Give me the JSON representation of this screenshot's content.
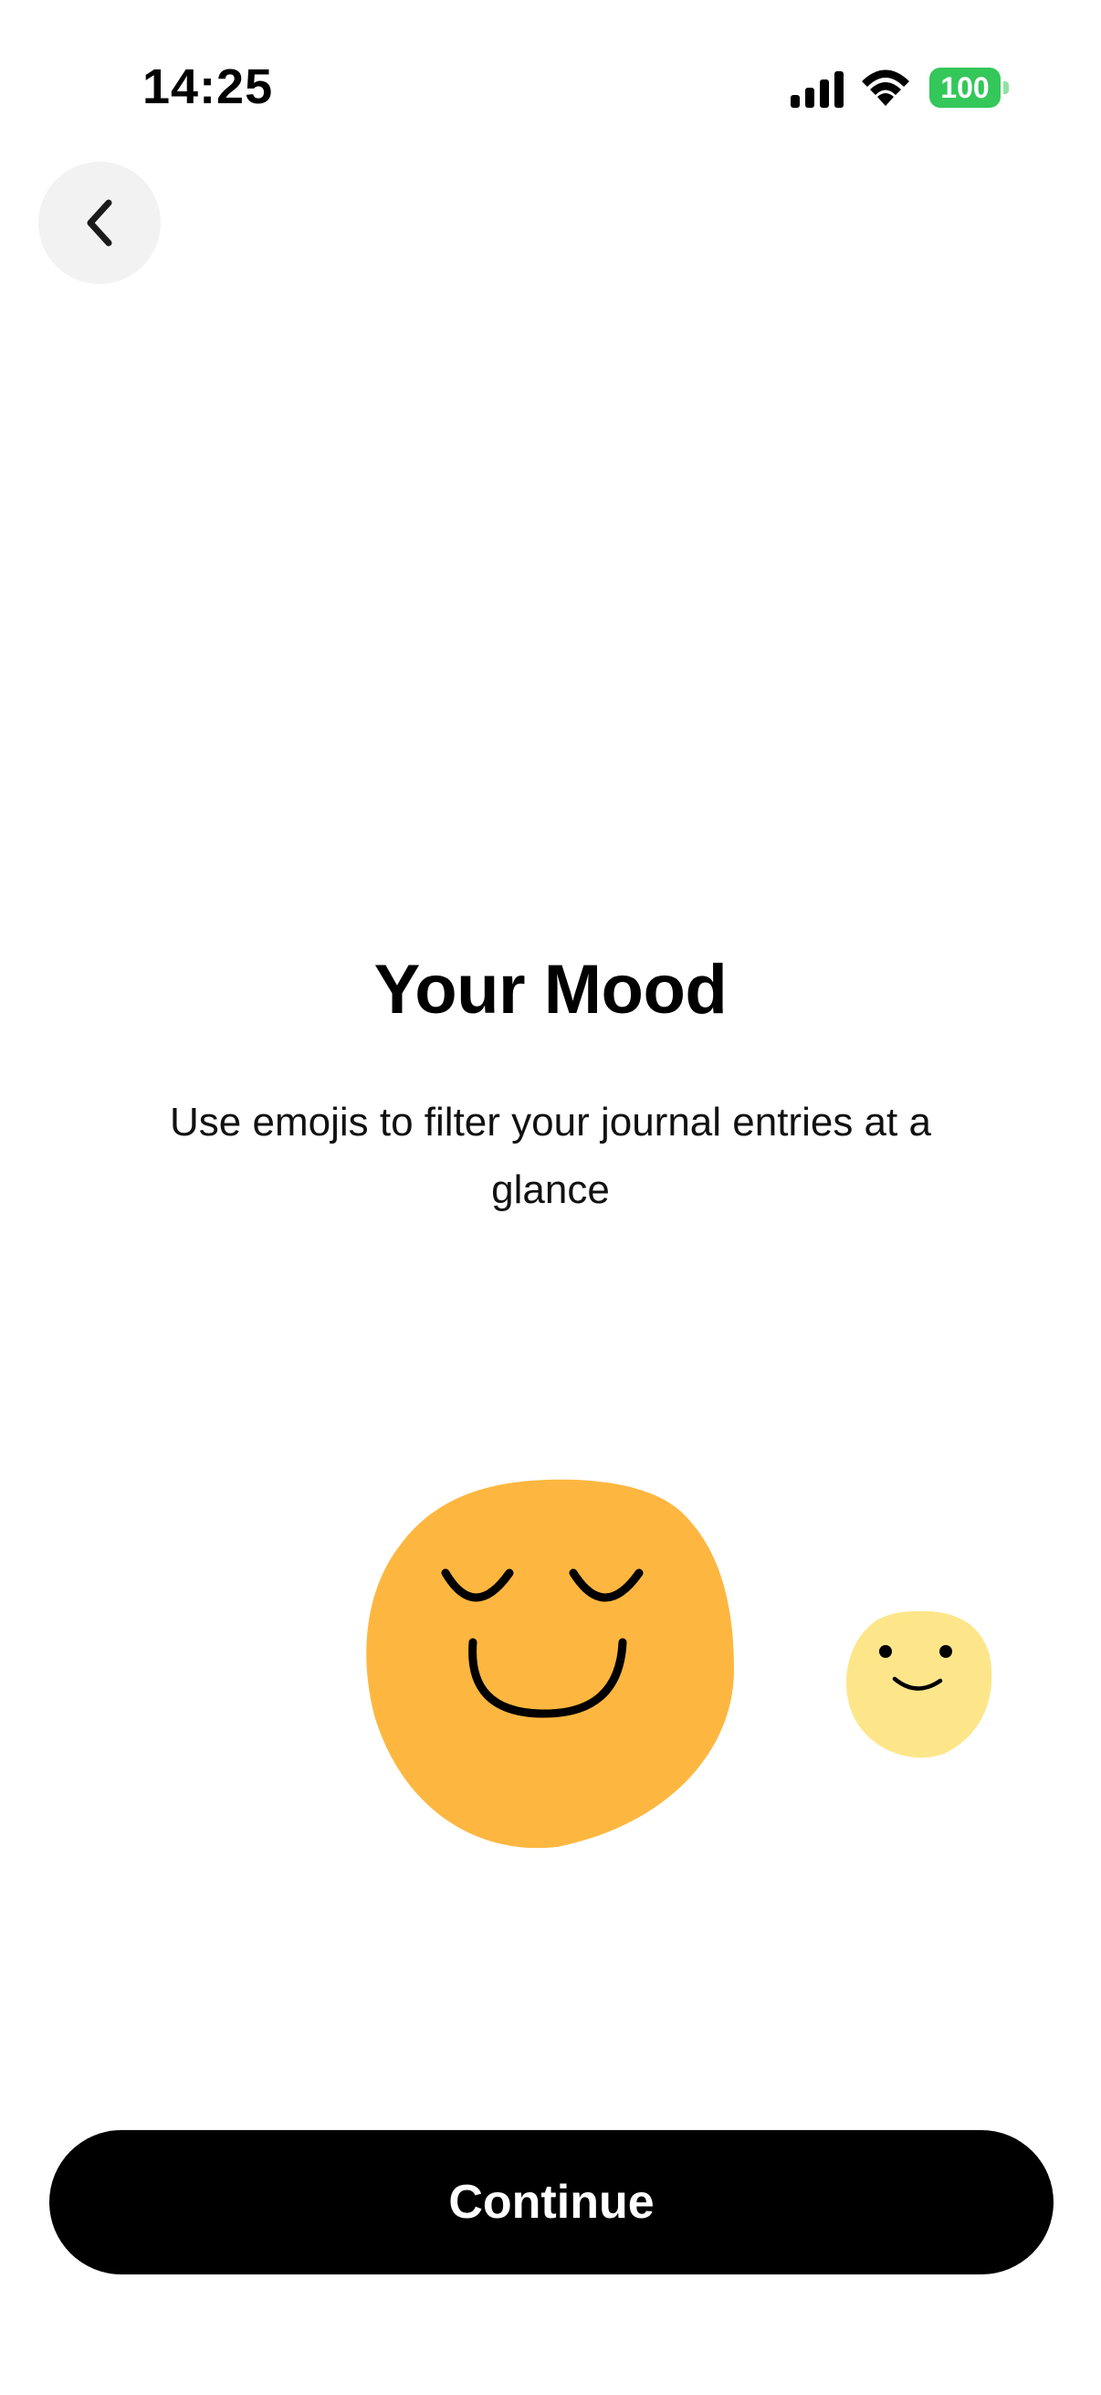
{
  "status_bar": {
    "time": "14:25",
    "battery": "100",
    "icons": [
      "signal-icon",
      "wifi-icon",
      "battery-icon"
    ]
  },
  "nav": {
    "back_icon": "chevron-left-icon"
  },
  "content": {
    "title": "Your Mood",
    "subtitle": "Use emojis to filter your journal entries at a glance"
  },
  "illustrations": {
    "primary": "content-face-emoji",
    "secondary": "smiling-face-emoji"
  },
  "footer": {
    "continue_label": "Continue"
  },
  "colors": {
    "accent": "#000000",
    "emoji_primary": "#FDB740",
    "emoji_secondary": "#FDE68A",
    "battery": "#34C759",
    "back_button_bg": "#F2F2F2"
  }
}
